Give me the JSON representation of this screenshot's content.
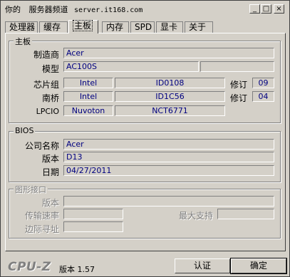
{
  "window": {
    "title": "你的",
    "title_site": "服务器频道",
    "title_url": "server.it168.com",
    "minimize": "_",
    "maximize": "□",
    "close": "×"
  },
  "tabs": [
    {
      "label": "处理器"
    },
    {
      "label": "缓存"
    },
    {
      "label": "主板"
    },
    {
      "label": "内存"
    },
    {
      "label": "SPD"
    },
    {
      "label": "显卡"
    },
    {
      "label": "关于"
    }
  ],
  "active_tab": "主板",
  "mainboard": {
    "group_title": "主板",
    "manufacturer_label": "制造商",
    "manufacturer_value": "Acer",
    "model_label": "模型",
    "model_value": "AC100S",
    "model_extra": "",
    "chipset_label": "芯片组",
    "chipset_vendor": "Intel",
    "chipset_id": "ID0108",
    "chipset_rev_label": "修订",
    "chipset_rev": "09",
    "southbridge_label": "南桥",
    "southbridge_vendor": "Intel",
    "southbridge_id": "ID1C56",
    "southbridge_rev_label": "修订",
    "southbridge_rev": "04",
    "lpcio_label": "LPCIO",
    "lpcio_vendor": "Nuvoton",
    "lpcio_model": "NCT6771"
  },
  "bios": {
    "group_title": "BIOS",
    "brand_label": "公司名称",
    "brand_value": "Acer",
    "version_label": "版本",
    "version_value": "D13",
    "date_label": "日期",
    "date_value": "04/27/2011"
  },
  "graphic_interface": {
    "group_title": "图形接口",
    "version_label": "版本",
    "version_value": "",
    "link_width_label": "传输速率",
    "link_width_value": "",
    "max_supported_label": "最大支持",
    "max_supported_value": "",
    "side_band_label": "边际寻址",
    "side_band_value": ""
  },
  "footer": {
    "logo": "CPU-Z",
    "version": "版本 1.57",
    "validate_button": "认证",
    "ok_button": "确定"
  }
}
